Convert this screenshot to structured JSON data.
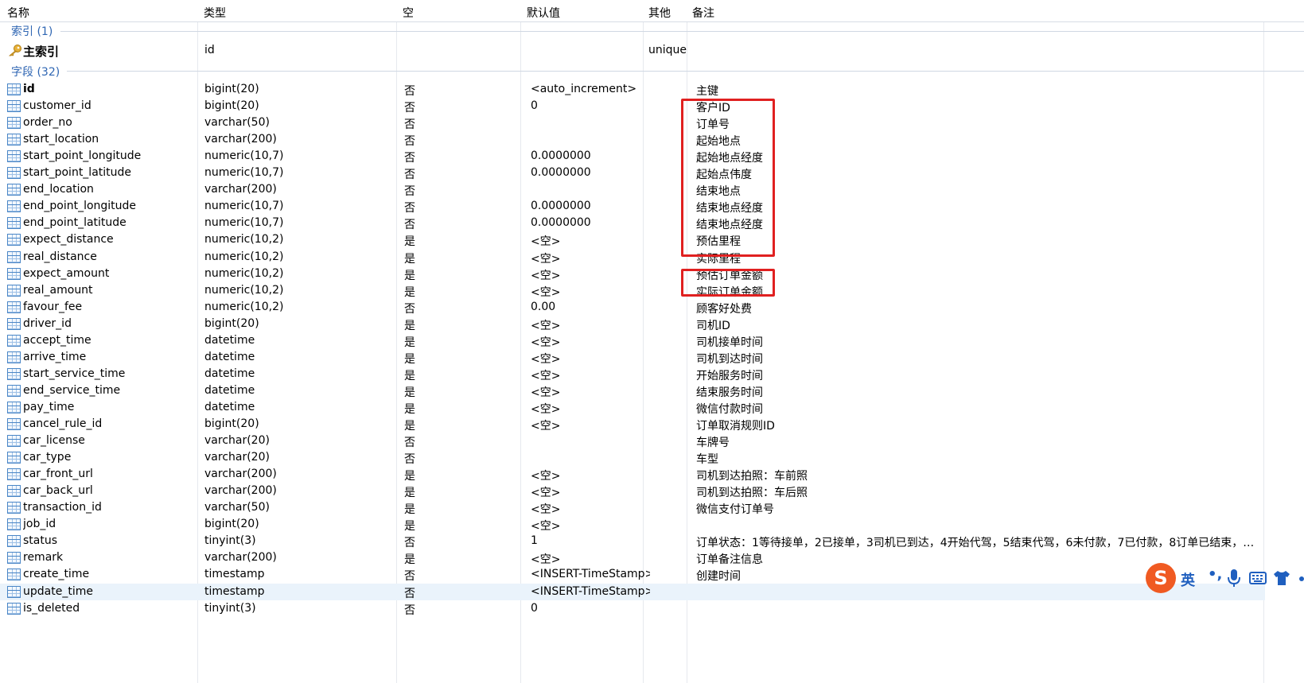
{
  "columns": {
    "name": "名称",
    "type": "类型",
    "null": "空",
    "default": "默认值",
    "extra": "其他",
    "comment": "备注"
  },
  "index_group": {
    "label": "索引 (1)"
  },
  "primary_index": {
    "name": "主索引",
    "type": "id",
    "extra": "unique"
  },
  "field_group": {
    "label": "字段 (32)"
  },
  "fields": [
    {
      "name": "id",
      "type": "bigint(20)",
      "null": "否",
      "default": "<auto_increment>",
      "comment": "主键"
    },
    {
      "name": "customer_id",
      "type": "bigint(20)",
      "null": "否",
      "default": "0",
      "comment": "客户ID"
    },
    {
      "name": "order_no",
      "type": "varchar(50)",
      "null": "否",
      "default": "",
      "comment": "订单号"
    },
    {
      "name": "start_location",
      "type": "varchar(200)",
      "null": "否",
      "default": "",
      "comment": "起始地点"
    },
    {
      "name": "start_point_longitude",
      "type": "numeric(10,7)",
      "null": "否",
      "default": "0.0000000",
      "comment": "起始地点经度"
    },
    {
      "name": "start_point_latitude",
      "type": "numeric(10,7)",
      "null": "否",
      "default": "0.0000000",
      "comment": "起始点伟度"
    },
    {
      "name": "end_location",
      "type": "varchar(200)",
      "null": "否",
      "default": "",
      "comment": "结束地点"
    },
    {
      "name": "end_point_longitude",
      "type": "numeric(10,7)",
      "null": "否",
      "default": "0.0000000",
      "comment": "结束地点经度"
    },
    {
      "name": "end_point_latitude",
      "type": "numeric(10,7)",
      "null": "否",
      "default": "0.0000000",
      "comment": "结束地点经度"
    },
    {
      "name": "expect_distance",
      "type": "numeric(10,2)",
      "null": "是",
      "default": "<空>",
      "comment": "预估里程"
    },
    {
      "name": "real_distance",
      "type": "numeric(10,2)",
      "null": "是",
      "default": "<空>",
      "comment": "实际里程"
    },
    {
      "name": "expect_amount",
      "type": "numeric(10,2)",
      "null": "是",
      "default": "<空>",
      "comment": "预估订单金额"
    },
    {
      "name": "real_amount",
      "type": "numeric(10,2)",
      "null": "是",
      "default": "<空>",
      "comment": "实际订单金额"
    },
    {
      "name": "favour_fee",
      "type": "numeric(10,2)",
      "null": "否",
      "default": "0.00",
      "comment": "顾客好处费"
    },
    {
      "name": "driver_id",
      "type": "bigint(20)",
      "null": "是",
      "default": "<空>",
      "comment": "司机ID"
    },
    {
      "name": "accept_time",
      "type": "datetime",
      "null": "是",
      "default": "<空>",
      "comment": "司机接单时间"
    },
    {
      "name": "arrive_time",
      "type": "datetime",
      "null": "是",
      "default": "<空>",
      "comment": "司机到达时间"
    },
    {
      "name": "start_service_time",
      "type": "datetime",
      "null": "是",
      "default": "<空>",
      "comment": "开始服务时间"
    },
    {
      "name": "end_service_time",
      "type": "datetime",
      "null": "是",
      "default": "<空>",
      "comment": "结束服务时间"
    },
    {
      "name": "pay_time",
      "type": "datetime",
      "null": "是",
      "default": "<空>",
      "comment": "微信付款时间"
    },
    {
      "name": "cancel_rule_id",
      "type": "bigint(20)",
      "null": "是",
      "default": "<空>",
      "comment": "订单取消规则ID"
    },
    {
      "name": "car_license",
      "type": "varchar(20)",
      "null": "否",
      "default": "",
      "comment": "车牌号"
    },
    {
      "name": "car_type",
      "type": "varchar(20)",
      "null": "否",
      "default": "",
      "comment": "车型"
    },
    {
      "name": "car_front_url",
      "type": "varchar(200)",
      "null": "是",
      "default": "<空>",
      "comment": "司机到达拍照：车前照"
    },
    {
      "name": "car_back_url",
      "type": "varchar(200)",
      "null": "是",
      "default": "<空>",
      "comment": "司机到达拍照：车后照"
    },
    {
      "name": "transaction_id",
      "type": "varchar(50)",
      "null": "是",
      "default": "<空>",
      "comment": "微信支付订单号"
    },
    {
      "name": "job_id",
      "type": "bigint(20)",
      "null": "是",
      "default": "<空>",
      "comment": ""
    },
    {
      "name": "status",
      "type": "tinyint(3)",
      "null": "否",
      "default": "1",
      "comment": "订单状态：1等待接单，2已接单，3司机已到达，4开始代驾，5结束代驾，6未付款，7已付款，8订单已结束，9..."
    },
    {
      "name": "remark",
      "type": "varchar(200)",
      "null": "是",
      "default": "<空>",
      "comment": "订单备注信息"
    },
    {
      "name": "create_time",
      "type": "timestamp",
      "null": "否",
      "default": "<INSERT-TimeStamp>",
      "comment": "创建时间"
    },
    {
      "name": "update_time",
      "type": "timestamp",
      "null": "否",
      "default": "<INSERT-TimeStamp>",
      "comment": ""
    },
    {
      "name": "is_deleted",
      "type": "tinyint(3)",
      "null": "否",
      "default": "0",
      "comment": ""
    }
  ],
  "ime": {
    "logo": "S",
    "lang": "英",
    "punct": "•,"
  },
  "colors": {
    "accent": "#2f66b3",
    "highlight": "#e02020",
    "selection": "#eaf3fb",
    "ime": "#f05a22"
  }
}
